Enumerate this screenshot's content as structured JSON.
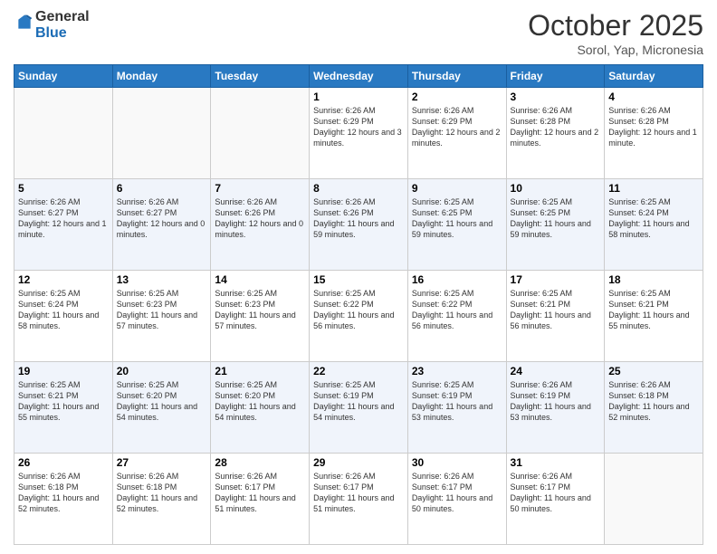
{
  "logo": {
    "general": "General",
    "blue": "Blue"
  },
  "header": {
    "month": "October 2025",
    "location": "Sorol, Yap, Micronesia"
  },
  "weekdays": [
    "Sunday",
    "Monday",
    "Tuesday",
    "Wednesday",
    "Thursday",
    "Friday",
    "Saturday"
  ],
  "weeks": [
    [
      {
        "day": "",
        "info": ""
      },
      {
        "day": "",
        "info": ""
      },
      {
        "day": "",
        "info": ""
      },
      {
        "day": "1",
        "info": "Sunrise: 6:26 AM\nSunset: 6:29 PM\nDaylight: 12 hours and 3 minutes."
      },
      {
        "day": "2",
        "info": "Sunrise: 6:26 AM\nSunset: 6:29 PM\nDaylight: 12 hours and 2 minutes."
      },
      {
        "day": "3",
        "info": "Sunrise: 6:26 AM\nSunset: 6:28 PM\nDaylight: 12 hours and 2 minutes."
      },
      {
        "day": "4",
        "info": "Sunrise: 6:26 AM\nSunset: 6:28 PM\nDaylight: 12 hours and 1 minute."
      }
    ],
    [
      {
        "day": "5",
        "info": "Sunrise: 6:26 AM\nSunset: 6:27 PM\nDaylight: 12 hours and 1 minute."
      },
      {
        "day": "6",
        "info": "Sunrise: 6:26 AM\nSunset: 6:27 PM\nDaylight: 12 hours and 0 minutes."
      },
      {
        "day": "7",
        "info": "Sunrise: 6:26 AM\nSunset: 6:26 PM\nDaylight: 12 hours and 0 minutes."
      },
      {
        "day": "8",
        "info": "Sunrise: 6:26 AM\nSunset: 6:26 PM\nDaylight: 11 hours and 59 minutes."
      },
      {
        "day": "9",
        "info": "Sunrise: 6:25 AM\nSunset: 6:25 PM\nDaylight: 11 hours and 59 minutes."
      },
      {
        "day": "10",
        "info": "Sunrise: 6:25 AM\nSunset: 6:25 PM\nDaylight: 11 hours and 59 minutes."
      },
      {
        "day": "11",
        "info": "Sunrise: 6:25 AM\nSunset: 6:24 PM\nDaylight: 11 hours and 58 minutes."
      }
    ],
    [
      {
        "day": "12",
        "info": "Sunrise: 6:25 AM\nSunset: 6:24 PM\nDaylight: 11 hours and 58 minutes."
      },
      {
        "day": "13",
        "info": "Sunrise: 6:25 AM\nSunset: 6:23 PM\nDaylight: 11 hours and 57 minutes."
      },
      {
        "day": "14",
        "info": "Sunrise: 6:25 AM\nSunset: 6:23 PM\nDaylight: 11 hours and 57 minutes."
      },
      {
        "day": "15",
        "info": "Sunrise: 6:25 AM\nSunset: 6:22 PM\nDaylight: 11 hours and 56 minutes."
      },
      {
        "day": "16",
        "info": "Sunrise: 6:25 AM\nSunset: 6:22 PM\nDaylight: 11 hours and 56 minutes."
      },
      {
        "day": "17",
        "info": "Sunrise: 6:25 AM\nSunset: 6:21 PM\nDaylight: 11 hours and 56 minutes."
      },
      {
        "day": "18",
        "info": "Sunrise: 6:25 AM\nSunset: 6:21 PM\nDaylight: 11 hours and 55 minutes."
      }
    ],
    [
      {
        "day": "19",
        "info": "Sunrise: 6:25 AM\nSunset: 6:21 PM\nDaylight: 11 hours and 55 minutes."
      },
      {
        "day": "20",
        "info": "Sunrise: 6:25 AM\nSunset: 6:20 PM\nDaylight: 11 hours and 54 minutes."
      },
      {
        "day": "21",
        "info": "Sunrise: 6:25 AM\nSunset: 6:20 PM\nDaylight: 11 hours and 54 minutes."
      },
      {
        "day": "22",
        "info": "Sunrise: 6:25 AM\nSunset: 6:19 PM\nDaylight: 11 hours and 54 minutes."
      },
      {
        "day": "23",
        "info": "Sunrise: 6:25 AM\nSunset: 6:19 PM\nDaylight: 11 hours and 53 minutes."
      },
      {
        "day": "24",
        "info": "Sunrise: 6:26 AM\nSunset: 6:19 PM\nDaylight: 11 hours and 53 minutes."
      },
      {
        "day": "25",
        "info": "Sunrise: 6:26 AM\nSunset: 6:18 PM\nDaylight: 11 hours and 52 minutes."
      }
    ],
    [
      {
        "day": "26",
        "info": "Sunrise: 6:26 AM\nSunset: 6:18 PM\nDaylight: 11 hours and 52 minutes."
      },
      {
        "day": "27",
        "info": "Sunrise: 6:26 AM\nSunset: 6:18 PM\nDaylight: 11 hours and 52 minutes."
      },
      {
        "day": "28",
        "info": "Sunrise: 6:26 AM\nSunset: 6:17 PM\nDaylight: 11 hours and 51 minutes."
      },
      {
        "day": "29",
        "info": "Sunrise: 6:26 AM\nSunset: 6:17 PM\nDaylight: 11 hours and 51 minutes."
      },
      {
        "day": "30",
        "info": "Sunrise: 6:26 AM\nSunset: 6:17 PM\nDaylight: 11 hours and 50 minutes."
      },
      {
        "day": "31",
        "info": "Sunrise: 6:26 AM\nSunset: 6:17 PM\nDaylight: 11 hours and 50 minutes."
      },
      {
        "day": "",
        "info": ""
      }
    ]
  ]
}
